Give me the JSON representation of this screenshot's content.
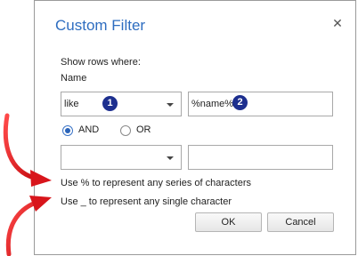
{
  "dialog": {
    "title": "Custom Filter",
    "close_glyph": "✕"
  },
  "filter": {
    "show_rows_label": "Show rows where:",
    "field_name": "Name",
    "condition1": {
      "operator": "like",
      "value": "%name%"
    },
    "logic": {
      "and_label": "AND",
      "or_label": "OR",
      "selected": "AND"
    },
    "condition2": {
      "operator": "",
      "value": ""
    }
  },
  "hints": {
    "percent": "Use % to represent any series of characters",
    "underscore": "Use _ to represent any single character"
  },
  "buttons": {
    "ok": "OK",
    "cancel": "Cancel"
  },
  "badges": {
    "one": "1",
    "two": "2"
  },
  "colors": {
    "title": "#2e6dc0",
    "badge": "#1d2f8f",
    "arrow": "#e8141a"
  }
}
